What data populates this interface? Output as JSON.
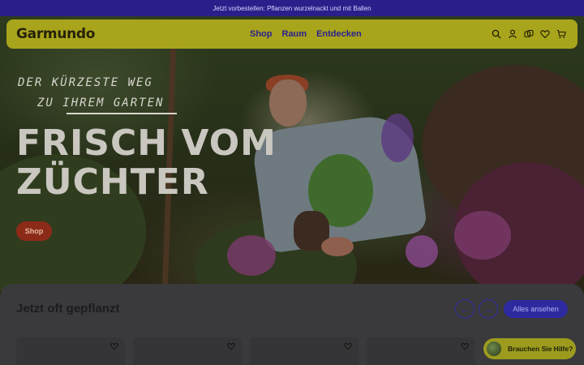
{
  "announcement": {
    "text": "Jetzt vorbestellen: Pflanzen wurzelnackt und mit Ballen"
  },
  "header": {
    "logo": "Garmundo",
    "nav": [
      {
        "label": "Shop"
      },
      {
        "label": "Raum"
      },
      {
        "label": "Entdecken"
      }
    ],
    "icons": [
      "search-icon",
      "account-icon",
      "compare-icon",
      "wishlist-icon",
      "cart-icon"
    ]
  },
  "hero": {
    "tagline_line1": "DER KÜRZESTE WEG",
    "tagline_line2": "ZU IHREM GARTEN",
    "headline_line1": "FRISCH VOM",
    "headline_line2": "ZÜCHTER",
    "cta": "Shop"
  },
  "section": {
    "title": "Jetzt oft gepflanzt",
    "prev_label": "←",
    "next_label": "→",
    "view_all": "Alles ansehen"
  },
  "help": {
    "label": "Brauchen Sie Hilfe?"
  },
  "colors": {
    "announcement_bg": "#2a1f8a",
    "header_bg": "#a8a41c",
    "nav_link": "#2a2090",
    "cta_bg": "#8c2a18",
    "accent": "#2d2aa0"
  }
}
